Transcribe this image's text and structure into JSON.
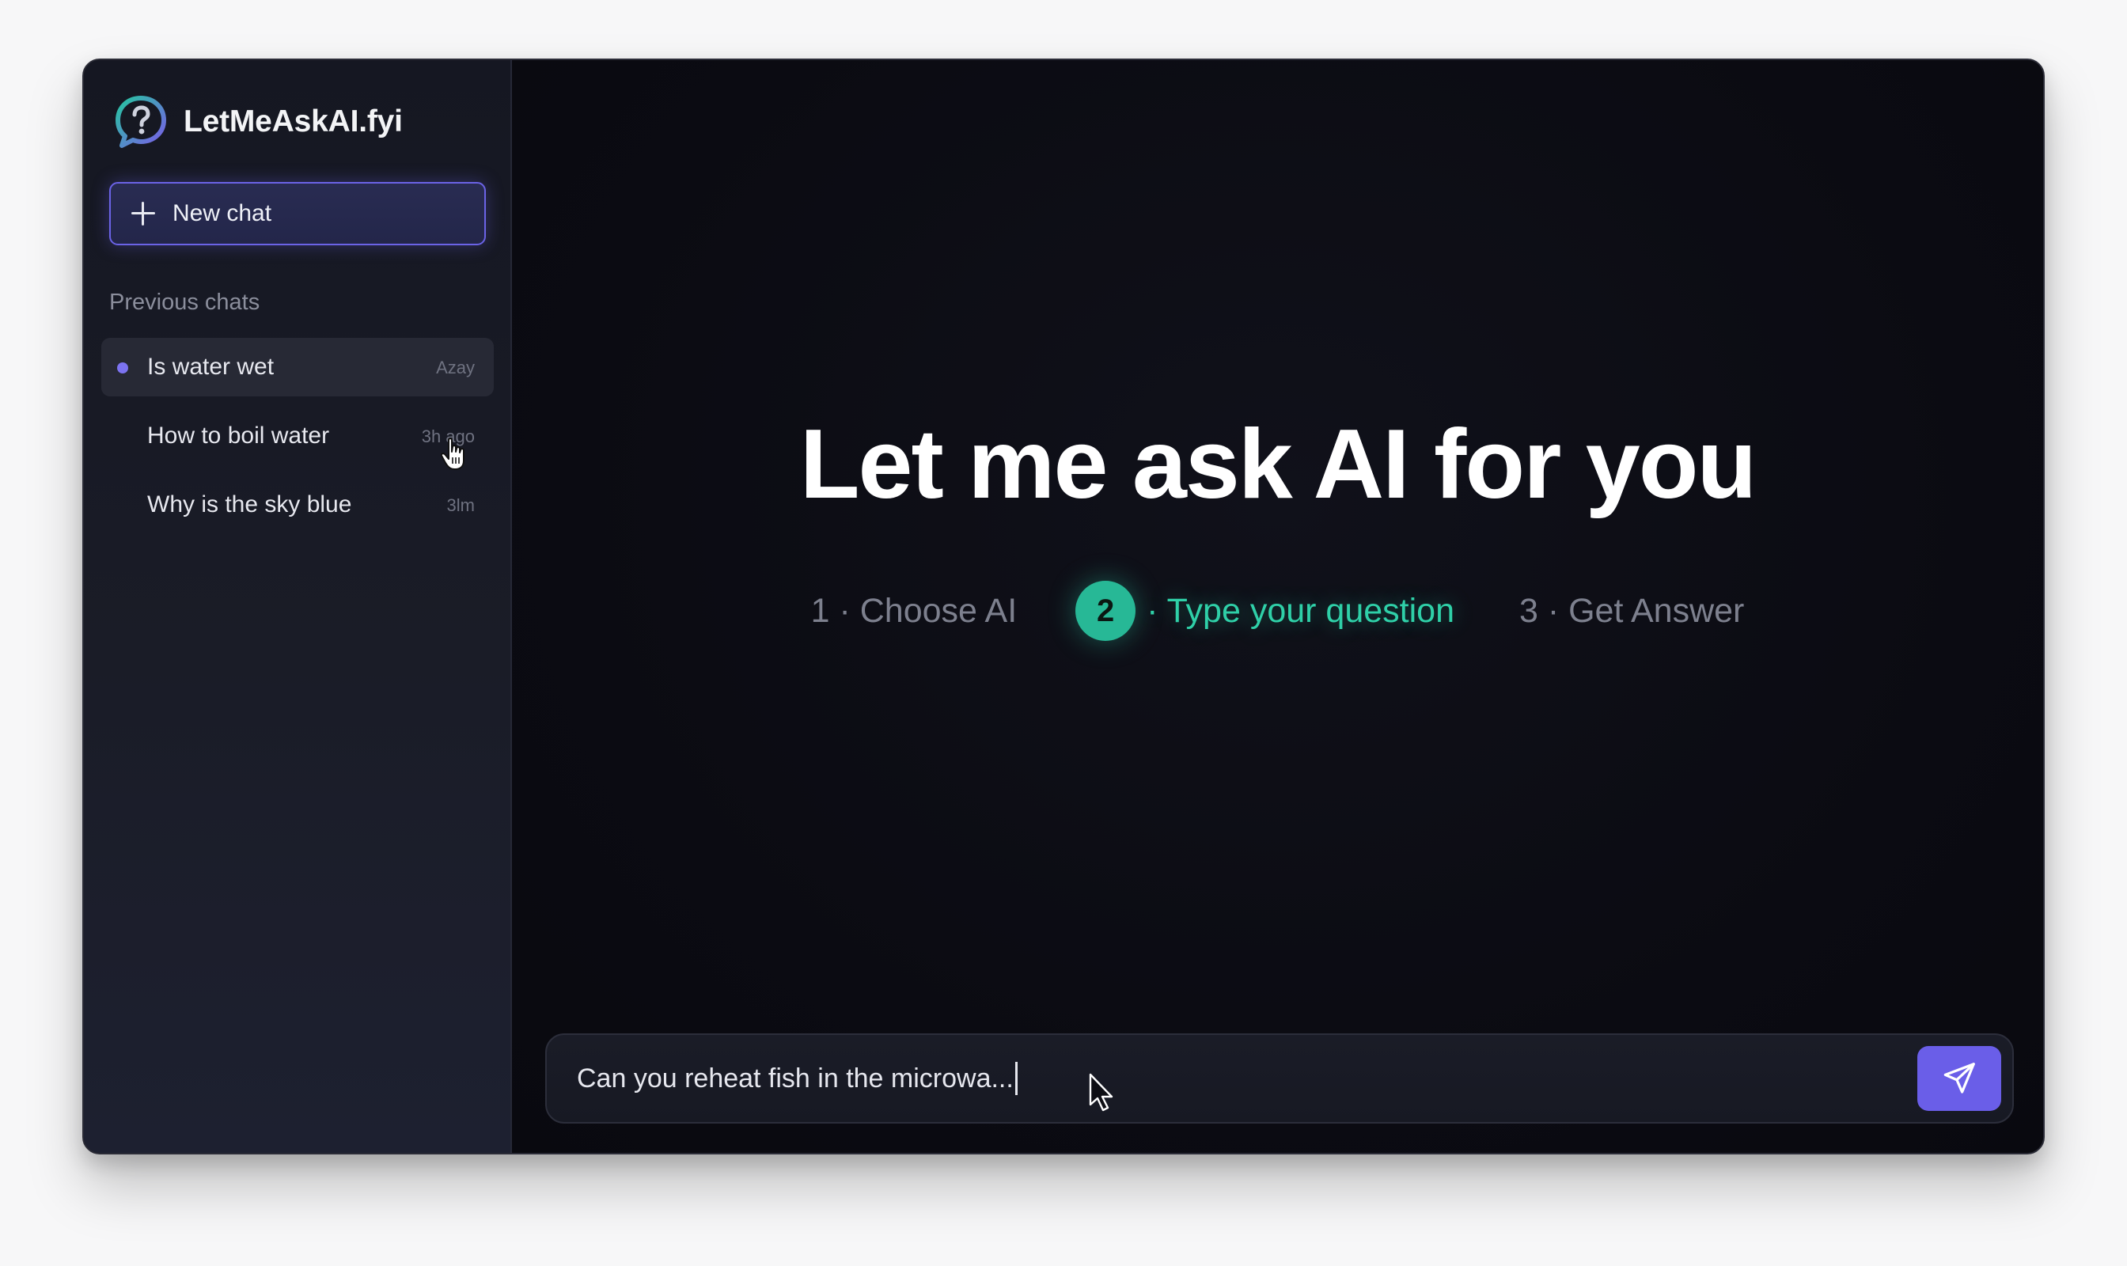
{
  "brand": {
    "name": "LetMeAskAI.fyi",
    "logo_icon": "question-bubble-icon"
  },
  "sidebar": {
    "new_chat_label": "New chat",
    "section_label": "Previous chats",
    "chats": [
      {
        "title": "Is water wet",
        "time": "Azay",
        "active": true
      },
      {
        "title": "How to boil water",
        "time": "3h ago",
        "active": false
      },
      {
        "title": "Why is the sky blue",
        "time": "3lm",
        "active": false
      }
    ]
  },
  "hero": {
    "title": "Let me ask AI for you"
  },
  "steps": [
    {
      "label": "1 · Choose AI",
      "state": "inactive"
    },
    {
      "number": "2",
      "label": "· Type your question",
      "state": "current"
    },
    {
      "label": "3 · Get Answer",
      "state": "inactive"
    }
  ],
  "composer": {
    "value": "Can you reheat fish in the microwa...",
    "send_icon": "paper-plane-icon"
  },
  "colors": {
    "accent": "#6a5ee8",
    "step_active": "#2fd0a8",
    "background": "#0b0b12",
    "sidebar": "#181a25"
  }
}
